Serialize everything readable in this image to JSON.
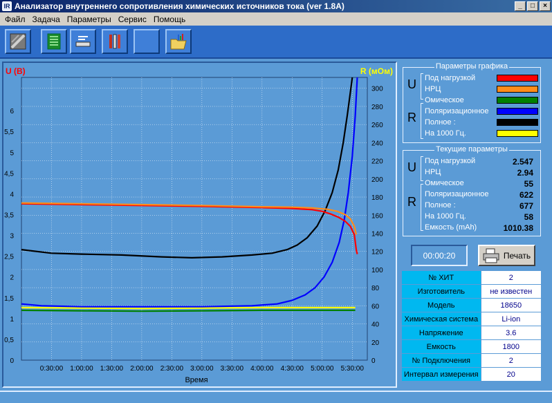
{
  "window": {
    "title": "Анализатор внутреннего сопротивления химических источников тока (ver 1.8A)"
  },
  "menu": [
    "Файл",
    "Задача",
    "Параметры",
    "Сервис",
    "Помощь"
  ],
  "toolbar_icons": [
    "battery-icon",
    "table-icon",
    "settings-icon",
    "tools-icon",
    "blank-icon",
    "folder-chart-icon"
  ],
  "chart_data": {
    "type": "line",
    "ylabel_left": "U (B)",
    "ylabel_right": "R (мОм)",
    "xlabel": "Время",
    "x_ticks": [
      "0:30:00",
      "1:00:00",
      "1:30:00",
      "2:00:00",
      "2:30:00",
      "3:00:00",
      "3:30:00",
      "4:00:00",
      "4:30:00",
      "5:00:00",
      "5:30:00"
    ],
    "y_left_ticks": [
      "0",
      "0,5",
      "1",
      "1,5",
      "2",
      "2,5",
      "3",
      "3,5",
      "4",
      "4,5",
      "5",
      "5,5",
      "6"
    ],
    "y_right_ticks": [
      "0",
      "20",
      "40",
      "60",
      "80",
      "100",
      "120",
      "140",
      "160",
      "180",
      "200",
      "220",
      "240",
      "260",
      "280",
      "300"
    ],
    "y_left_range": [
      0,
      6.8
    ],
    "y_right_range": [
      0,
      312
    ],
    "x_range_minutes": [
      0,
      345
    ],
    "grid": true,
    "series": [
      {
        "name": "НРЦ",
        "axis": "left",
        "color": "#ff8c1a",
        "points": [
          [
            0,
            3.78
          ],
          [
            60,
            3.76
          ],
          [
            120,
            3.74
          ],
          [
            180,
            3.72
          ],
          [
            240,
            3.69
          ],
          [
            270,
            3.68
          ],
          [
            290,
            3.66
          ],
          [
            305,
            3.63
          ],
          [
            315,
            3.58
          ],
          [
            323,
            3.5
          ],
          [
            328,
            3.4
          ],
          [
            332,
            3.22
          ],
          [
            334,
            3.02
          ]
        ]
      },
      {
        "name": "Под нагрузкой",
        "axis": "left",
        "color": "#ff0000",
        "points": [
          [
            0,
            3.76
          ],
          [
            60,
            3.74
          ],
          [
            120,
            3.72
          ],
          [
            180,
            3.7
          ],
          [
            240,
            3.67
          ],
          [
            270,
            3.65
          ],
          [
            290,
            3.62
          ],
          [
            300,
            3.58
          ],
          [
            308,
            3.52
          ],
          [
            316,
            3.44
          ],
          [
            323,
            3.34
          ],
          [
            328,
            3.22
          ],
          [
            332,
            3.02
          ],
          [
            334,
            2.65
          ],
          [
            335,
            2.55
          ]
        ]
      },
      {
        "name": "Полное",
        "axis": "right",
        "color": "#000000",
        "points": [
          [
            0,
            122
          ],
          [
            30,
            118
          ],
          [
            60,
            117
          ],
          [
            100,
            116
          ],
          [
            140,
            114
          ],
          [
            170,
            113
          ],
          [
            200,
            114
          ],
          [
            230,
            116
          ],
          [
            250,
            118
          ],
          [
            265,
            122
          ],
          [
            275,
            127
          ],
          [
            285,
            135
          ],
          [
            295,
            148
          ],
          [
            303,
            165
          ],
          [
            310,
            185
          ],
          [
            316,
            210
          ],
          [
            321,
            240
          ],
          [
            325,
            270
          ],
          [
            328,
            295
          ],
          [
            330,
            312
          ]
        ]
      },
      {
        "name": "Поляризационное",
        "axis": "right",
        "color": "#0000ff",
        "points": [
          [
            0,
            62
          ],
          [
            20,
            60
          ],
          [
            60,
            59
          ],
          [
            120,
            59
          ],
          [
            180,
            59
          ],
          [
            230,
            60
          ],
          [
            255,
            62
          ],
          [
            270,
            66
          ],
          [
            283,
            72
          ],
          [
            293,
            80
          ],
          [
            302,
            92
          ],
          [
            310,
            108
          ],
          [
            317,
            130
          ],
          [
            322,
            155
          ],
          [
            326,
            185
          ],
          [
            330,
            225
          ],
          [
            333,
            270
          ],
          [
            335,
            312
          ]
        ]
      },
      {
        "name": "На 1000 Гц.",
        "axis": "right",
        "color": "#ffff00",
        "points": [
          [
            0,
            58
          ],
          [
            60,
            57.5
          ],
          [
            120,
            57
          ],
          [
            180,
            57.5
          ],
          [
            240,
            58
          ],
          [
            300,
            58
          ],
          [
            333,
            58
          ]
        ]
      },
      {
        "name": "Омическое",
        "axis": "right",
        "color": "#008000",
        "points": [
          [
            0,
            55
          ],
          [
            60,
            54.5
          ],
          [
            120,
            54
          ],
          [
            180,
            54.5
          ],
          [
            240,
            55
          ],
          [
            300,
            55
          ],
          [
            333,
            55
          ]
        ]
      }
    ]
  },
  "graph_params": {
    "title": "Параметры графика",
    "u_letter": "U",
    "r_letter": "R",
    "items": [
      {
        "label": "Под нагрузкой",
        "color": "#ff0000"
      },
      {
        "label": "НРЦ",
        "color": "#ff8c1a"
      },
      {
        "label": "Омическое",
        "color": "#008000"
      },
      {
        "label": "Поляризационное",
        "color": "#0000ff"
      },
      {
        "label": "Полное :",
        "color": "#000000"
      },
      {
        "label": "На 1000 Гц.",
        "color": "#ffff00"
      }
    ]
  },
  "current_params": {
    "title": "Текущие параметры",
    "u_letter": "U",
    "r_letter": "R",
    "items": [
      {
        "label": "Под нагрузкой",
        "value": "2.547"
      },
      {
        "label": "НРЦ",
        "value": "2.94"
      },
      {
        "label": "Омическое",
        "value": "55"
      },
      {
        "label": "Поляризационное",
        "value": "622"
      },
      {
        "label": "Полное :",
        "value": "677"
      },
      {
        "label": "На 1000 Гц.",
        "value": "58"
      },
      {
        "label": "Емкость (mAh)",
        "value": "1010.38"
      }
    ]
  },
  "timer": "00:00:20",
  "print_label": "Печать",
  "info": [
    {
      "key": "№ ХИТ",
      "value": "2"
    },
    {
      "key": "Изготовитель",
      "value": "не известен"
    },
    {
      "key": "Модель",
      "value": "18650"
    },
    {
      "key": "Химическая система",
      "value": "Li-ion"
    },
    {
      "key": "Напряжение",
      "value": "3.6"
    },
    {
      "key": "Емкость",
      "value": "1800"
    },
    {
      "key": "№ Подключения",
      "value": "2"
    },
    {
      "key": "Интервал измерения",
      "value": "20"
    }
  ]
}
